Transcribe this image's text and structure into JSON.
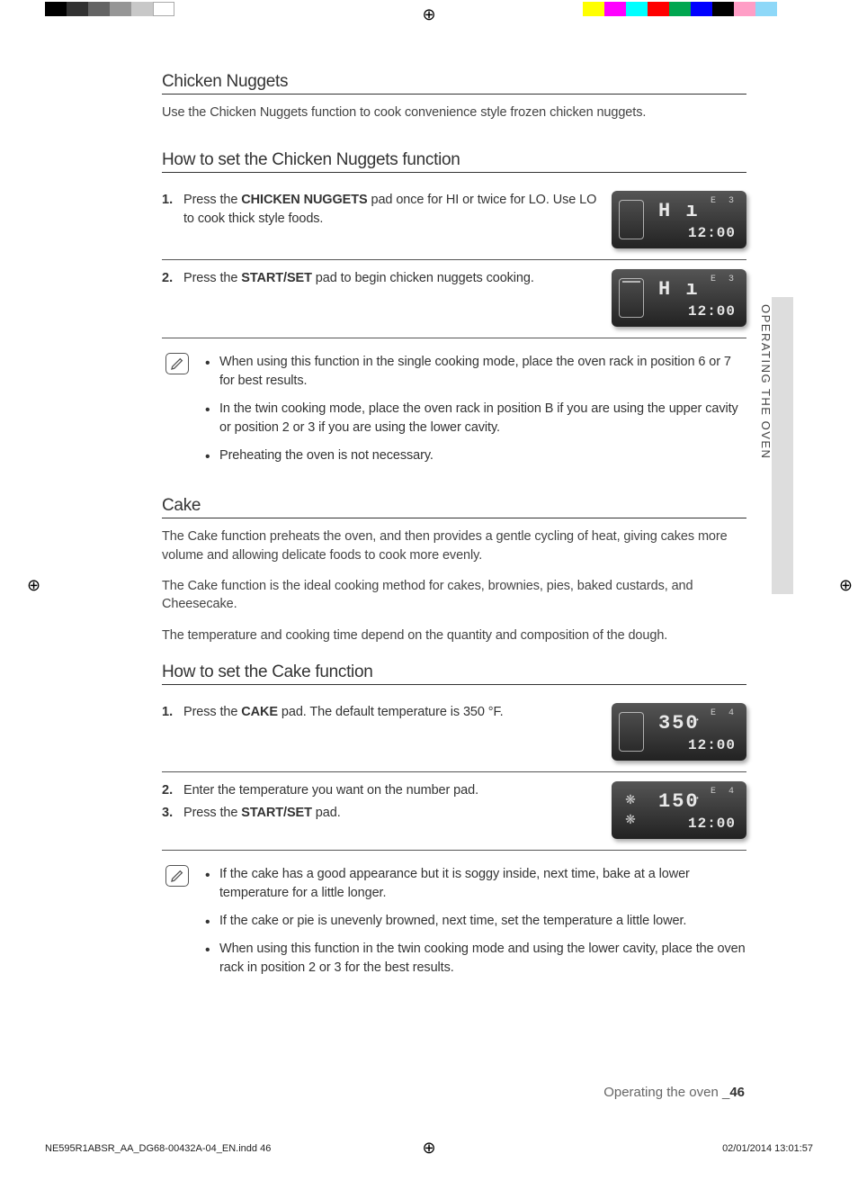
{
  "printer_marks": {
    "grays": [
      "#000000",
      "#323232",
      "#646464",
      "#969696",
      "#c8c8c8",
      "#ffffff"
    ],
    "colors": [
      "#ffff00",
      "#ff00ff",
      "#00ffff",
      "#ff0000",
      "#00a650",
      "#0000ff",
      "#000000",
      "#ff9ec6",
      "#8ed8f8"
    ]
  },
  "sections": {
    "chicken_nuggets": {
      "title": "Chicken Nuggets",
      "intro": "Use the Chicken Nuggets function to cook convenience style frozen chicken nuggets.",
      "howto_title": "How to set the Chicken Nuggets function",
      "steps": [
        {
          "num": "1",
          "text_pre": "Press the ",
          "text_bold": "CHICKEN NUGGETS",
          "text_post": " pad once for HI or twice for LO. Use LO to cook thick style foods.",
          "panel": {
            "main": "H ı",
            "corner": "E 3",
            "time": "12:00",
            "outline": true
          }
        },
        {
          "num": "2",
          "text_pre": "Press the ",
          "text_bold": "START/SET",
          "text_post": " pad to begin chicken nuggets cooking.",
          "panel": {
            "main": "H ı",
            "corner": "E 3",
            "time": "12:00",
            "outline": true,
            "bar": true
          }
        }
      ],
      "notes": [
        "When using this function in the single cooking mode, place the oven rack in position 6 or 7 for best results.",
        "In the twin cooking mode, place the oven rack in position B if you are using the upper cavity or position 2 or 3 if you are using the lower cavity.",
        "Preheating the oven is not necessary."
      ]
    },
    "cake": {
      "title": "Cake",
      "paras": [
        "The Cake function preheats the oven, and then provides a gentle cycling of heat, giving cakes more volume and allowing delicate foods to cook more evenly.",
        "The Cake function is the ideal cooking method for cakes, brownies, pies, baked custards, and Cheesecake.",
        "The temperature and cooking time depend on the quantity and composition of the dough."
      ],
      "howto_title": "How to set the Cake function",
      "steps": [
        {
          "lines": [
            {
              "num": "1",
              "text_pre": "Press the ",
              "text_bold": "CAKE",
              "text_post": " pad. The default temperature is 350 °F."
            }
          ],
          "panel": {
            "main": "350",
            "corner": "E 4",
            "time": "12:00",
            "outline": true,
            "dot": true
          }
        },
        {
          "lines": [
            {
              "num": "2",
              "text_pre": "Enter the temperature you want on the number pad.",
              "text_bold": "",
              "text_post": ""
            },
            {
              "num": "3",
              "text_pre": "Press the ",
              "text_bold": "START/SET",
              "text_post": " pad."
            }
          ],
          "panel": {
            "main": "150",
            "corner": "E 4",
            "time": "12:00",
            "fans": true,
            "dot": true
          }
        }
      ],
      "notes": [
        "If the cake has a good appearance but it is soggy inside, next time, bake at a lower temperature for a little longer.",
        "If the cake or pie is unevenly browned, next time, set the temperature a little lower.",
        "When using this function in the twin cooking mode and using the lower cavity, place the oven rack in position 2 or 3 for the best results."
      ]
    }
  },
  "sidebar": {
    "label": "OPERATING THE OVEN"
  },
  "footer": {
    "running_pre": "Operating the oven _",
    "running_page": "46",
    "file": "NE595R1ABSR_AA_DG68-00432A-04_EN.indd   46",
    "datetime": "02/01/2014   13:01:57"
  }
}
